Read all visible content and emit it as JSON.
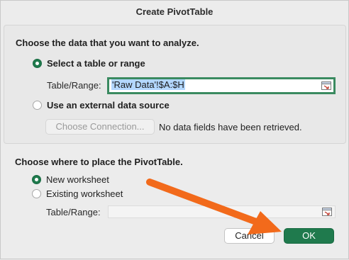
{
  "dialog": {
    "title": "Create PivotTable"
  },
  "data_section": {
    "heading": "Choose the data that you want to analyze.",
    "option_table": {
      "label": "Select a table or range",
      "selected": true
    },
    "table_range_label": "Table/Range:",
    "table_range_value": "'Raw Data'!$A:$H",
    "option_external": {
      "label": "Use an external data source",
      "selected": false
    },
    "choose_connection_label": "Choose Connection...",
    "no_fields_message": "No data fields have been retrieved."
  },
  "placement_section": {
    "heading": "Choose where to place the PivotTable.",
    "option_new": {
      "label": "New worksheet",
      "selected": true
    },
    "option_existing": {
      "label": "Existing worksheet",
      "selected": false
    },
    "table_range_label": "Table/Range:",
    "table_range_value": ""
  },
  "buttons": {
    "cancel_label": "Cancel",
    "ok_label": "OK"
  },
  "icons": {
    "range_picker": "range-collapse-icon"
  },
  "colors": {
    "accent": "#1f7a4d",
    "annotation_arrow": "#f26a1b",
    "focus_ring": "#3a8a60",
    "selection": "#b3d7ff"
  }
}
